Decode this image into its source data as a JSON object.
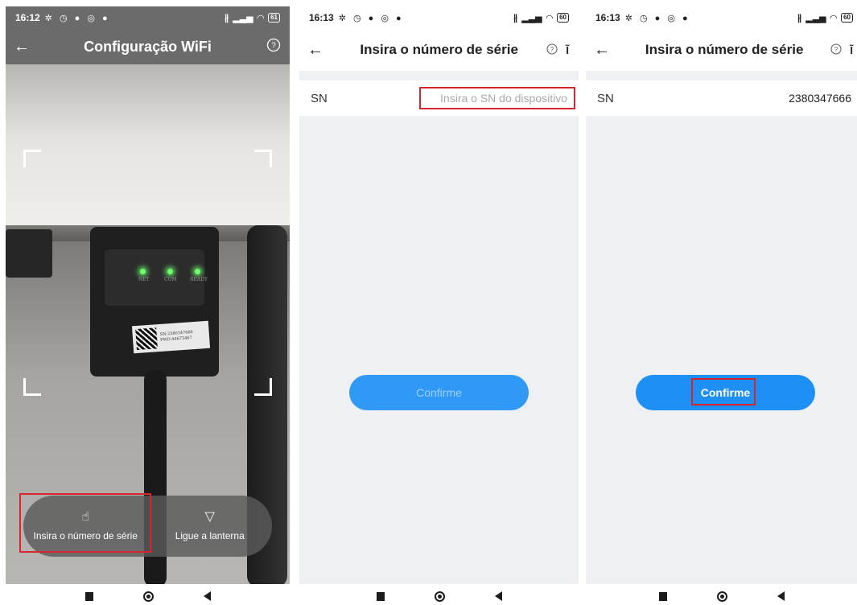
{
  "screen1": {
    "status": {
      "time": "16:12",
      "battery": "61"
    },
    "appbar": {
      "back": "←",
      "title": "Configuração WiFi",
      "help": "?"
    },
    "device": {
      "led_labels": [
        "NET",
        "COM",
        "READY"
      ],
      "sticker_sn": "SN:2380347666",
      "sticker_pwd": "PWD:44673467"
    },
    "toolbar": {
      "manual_icon": "hand-pointer-icon",
      "manual_label": "Insira o número de série",
      "torch_icon": "flashlight-icon",
      "torch_label": "Ligue a lanterna"
    }
  },
  "screen2": {
    "status": {
      "time": "16:13",
      "battery": "60"
    },
    "appbar": {
      "back": "←",
      "title": "Insira o número de série",
      "help": "?"
    },
    "sn": {
      "label": "SN",
      "placeholder": "Insira o SN do dispositivo",
      "value": ""
    },
    "confirm_label": "Confirme",
    "confirm_state": "disabled"
  },
  "screen3": {
    "status": {
      "time": "16:13",
      "battery": "60"
    },
    "appbar": {
      "back": "←",
      "title": "Insira o número de série",
      "help": "?"
    },
    "sn": {
      "label": "SN",
      "value": "2380347666"
    },
    "confirm_label": "Confirme",
    "confirm_state": "enabled"
  },
  "colors": {
    "accent": "#1e90f5",
    "highlight": "#d7262b",
    "background": "#eef0f3"
  }
}
